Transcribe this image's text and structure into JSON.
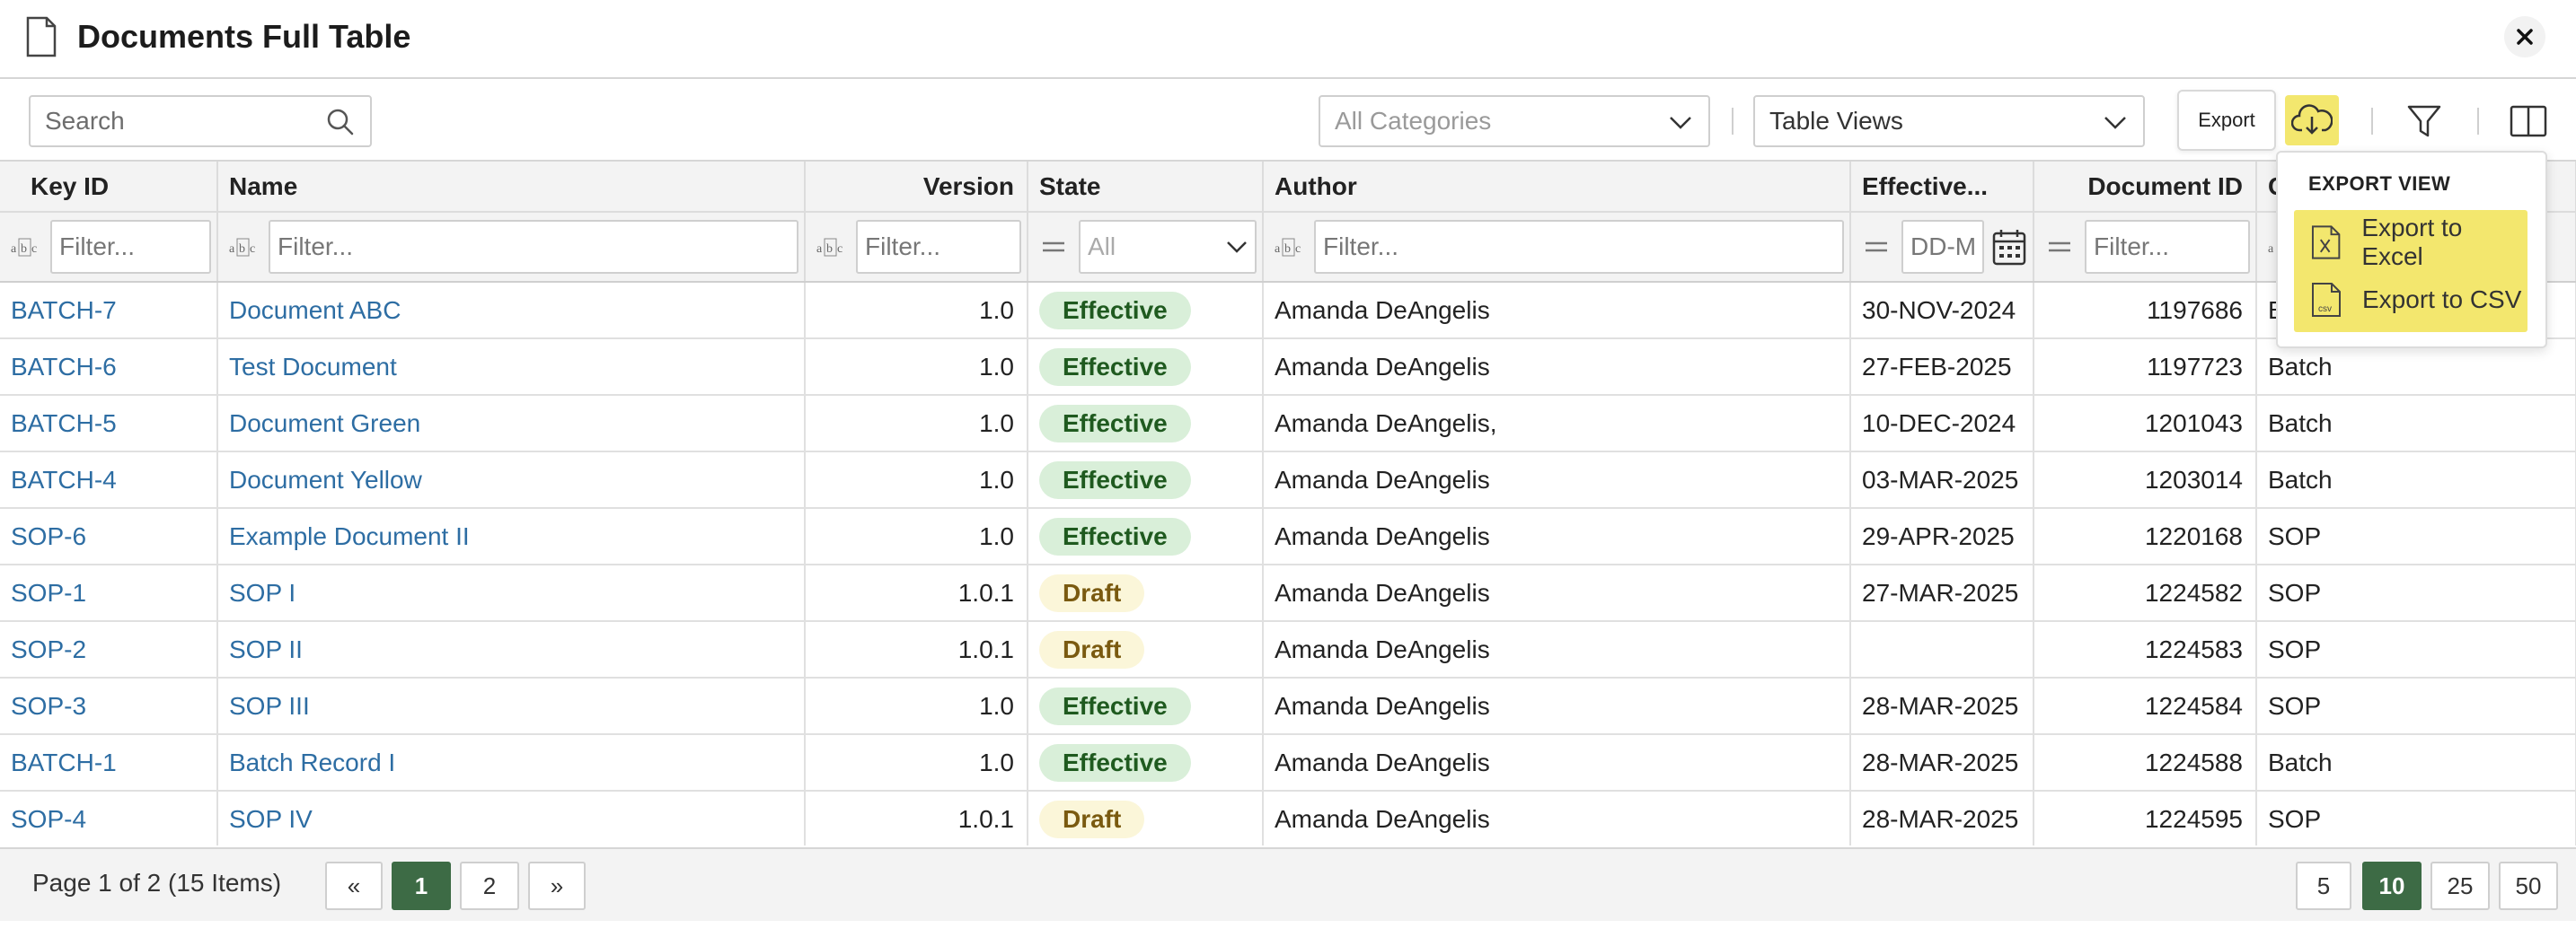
{
  "window": {
    "title": "Documents Full Table",
    "close_label": "✕"
  },
  "toolbar": {
    "search_placeholder": "Search",
    "category_select": "All Categories",
    "views_select": "Table Views",
    "export_tooltip": "Export"
  },
  "export_menu": {
    "header": "EXPORT VIEW",
    "items": [
      "Export to Excel",
      "Export to CSV"
    ]
  },
  "table": {
    "columns": [
      "Key ID",
      "Name",
      "Version",
      "State",
      "Author",
      "Effective...",
      "Document ID",
      "C"
    ],
    "filters": {
      "placeholder": "Filter...",
      "state_select": "All",
      "date_placeholder": "DD-M"
    },
    "rows": [
      {
        "key": "BATCH-7",
        "name": "Document ABC",
        "version": "1.0",
        "state": "Effective",
        "author": "Amanda DeAngelis",
        "effective": "30-NOV-2024",
        "doc_id": "1197686",
        "category": "Batch"
      },
      {
        "key": "BATCH-6",
        "name": "Test Document",
        "version": "1.0",
        "state": "Effective",
        "author": "Amanda DeAngelis",
        "effective": "27-FEB-2025",
        "doc_id": "1197723",
        "category": "Batch"
      },
      {
        "key": "BATCH-5",
        "name": "Document Green",
        "version": "1.0",
        "state": "Effective",
        "author": "Amanda DeAngelis,",
        "effective": "10-DEC-2024",
        "doc_id": "1201043",
        "category": "Batch"
      },
      {
        "key": "BATCH-4",
        "name": "Document Yellow",
        "version": "1.0",
        "state": "Effective",
        "author": "Amanda DeAngelis",
        "effective": "03-MAR-2025",
        "doc_id": "1203014",
        "category": "Batch"
      },
      {
        "key": "SOP-6",
        "name": "Example Document II",
        "version": "1.0",
        "state": "Effective",
        "author": "Amanda DeAngelis",
        "effective": "29-APR-2025",
        "doc_id": "1220168",
        "category": "SOP"
      },
      {
        "key": "SOP-1",
        "name": "SOP I",
        "version": "1.0.1",
        "state": "Draft",
        "author": "Amanda DeAngelis",
        "effective": "27-MAR-2025",
        "doc_id": "1224582",
        "category": "SOP"
      },
      {
        "key": "SOP-2",
        "name": "SOP II",
        "version": "1.0.1",
        "state": "Draft",
        "author": "Amanda DeAngelis",
        "effective": "",
        "doc_id": "1224583",
        "category": "SOP"
      },
      {
        "key": "SOP-3",
        "name": "SOP III",
        "version": "1.0",
        "state": "Effective",
        "author": "Amanda DeAngelis",
        "effective": "28-MAR-2025",
        "doc_id": "1224584",
        "category": "SOP"
      },
      {
        "key": "BATCH-1",
        "name": "Batch Record I",
        "version": "1.0",
        "state": "Effective",
        "author": "Amanda DeAngelis",
        "effective": "28-MAR-2025",
        "doc_id": "1224588",
        "category": "Batch"
      },
      {
        "key": "SOP-4",
        "name": "SOP IV",
        "version": "1.0.1",
        "state": "Draft",
        "author": "Amanda DeAngelis",
        "effective": "28-MAR-2025",
        "doc_id": "1224595",
        "category": "SOP"
      }
    ]
  },
  "pagination": {
    "info": "Page 1 of 2 (15 Items)",
    "prev": "«",
    "pages": [
      "1",
      "2"
    ],
    "next": "»",
    "active_page": "1",
    "sizes": [
      "5",
      "10",
      "25",
      "50"
    ],
    "active_size": "10"
  },
  "colors": {
    "accent": "#f3e76e",
    "link": "#2d6da3",
    "active_page": "#3d6b45",
    "effective_bg": "#d9efd9",
    "draft_bg": "#fbf6d9"
  },
  "icons": [
    "document-icon",
    "close-icon",
    "search-icon",
    "chevron-down-icon",
    "cloud-download-icon",
    "filter-icon",
    "columns-icon",
    "text-filter-icon",
    "equals-icon",
    "calendar-icon",
    "excel-file-icon",
    "csv-file-icon"
  ]
}
